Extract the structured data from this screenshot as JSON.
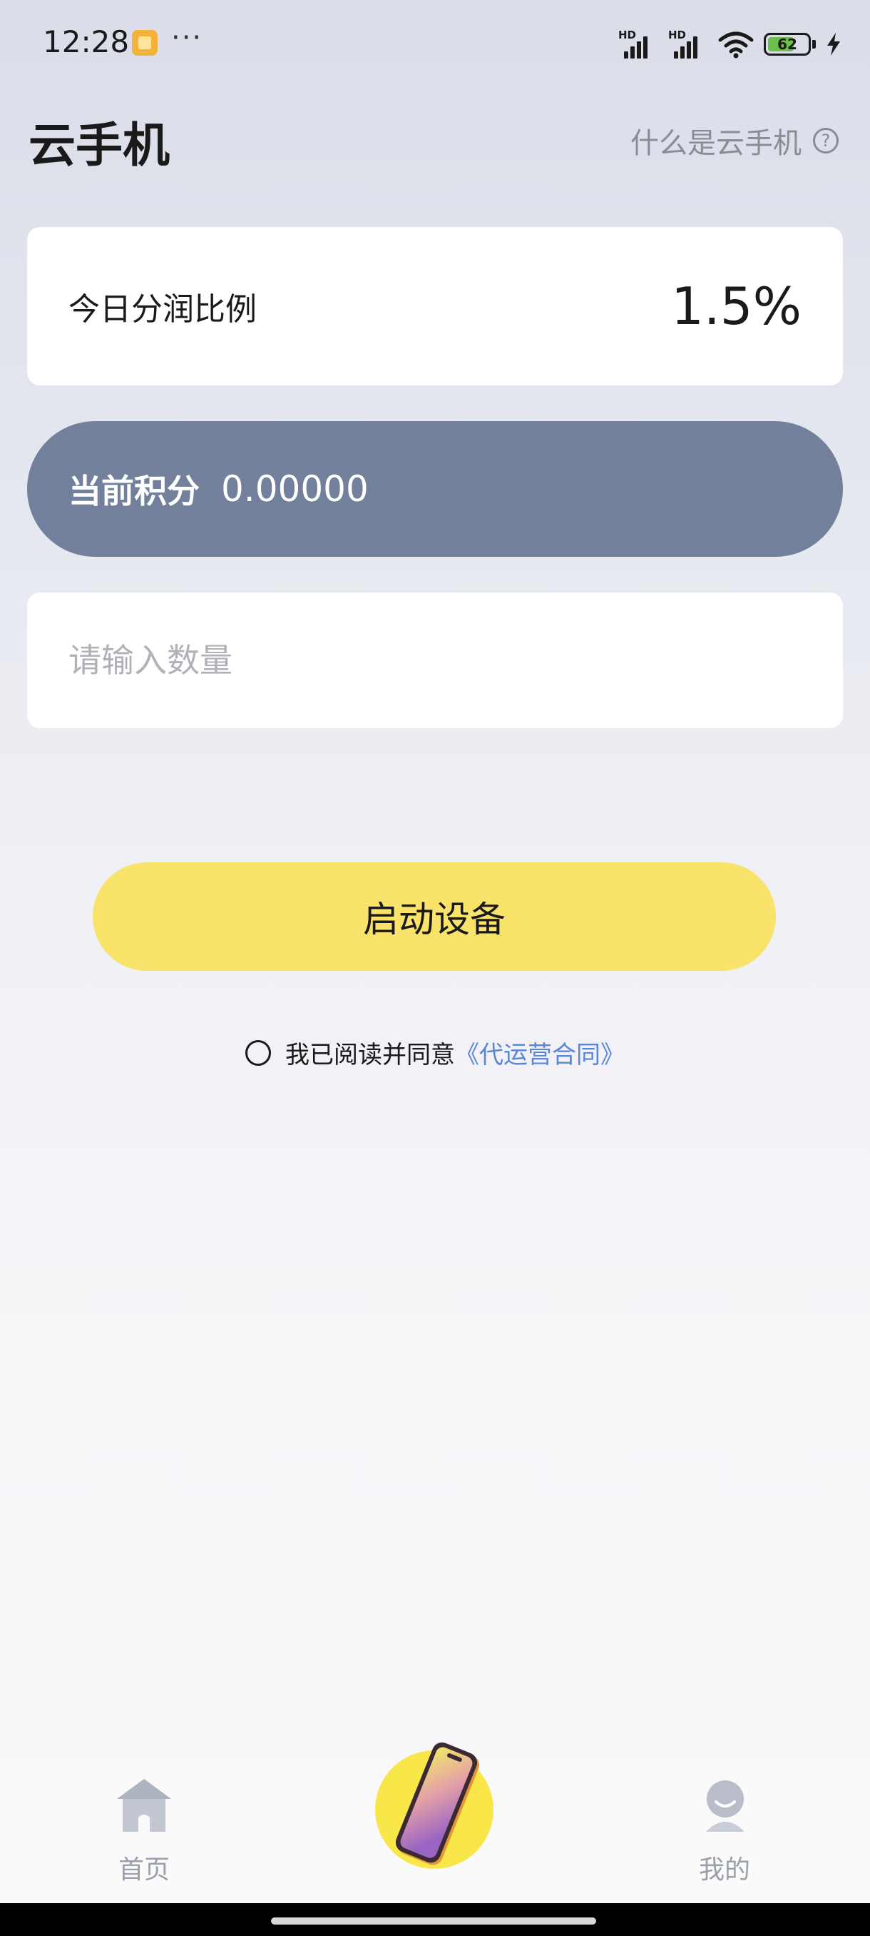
{
  "status_bar": {
    "time": "12:28",
    "dots": "···",
    "signal_1_label": "HD",
    "signal_2_label": "HD",
    "battery": "62"
  },
  "header": {
    "title": "云手机",
    "help_link": "什么是云手机",
    "help_icon_glyph": "?"
  },
  "ratio_card": {
    "label": "今日分润比例",
    "value": "1.5%"
  },
  "points": {
    "label": "当前积分",
    "value": "0.00000"
  },
  "quantity": {
    "placeholder": "请输入数量",
    "value": ""
  },
  "start_button": {
    "label": "启动设备"
  },
  "agreement": {
    "text": "我已阅读并同意",
    "link": "《代运营合同》",
    "checked": false
  },
  "tab_bar": {
    "home_label": "首页",
    "me_label": "我的",
    "center_icon": "phone-icon"
  },
  "colors": {
    "points_bg": "#72809c",
    "start_button_bg": "#f9e36a",
    "link": "#5a86d6"
  }
}
